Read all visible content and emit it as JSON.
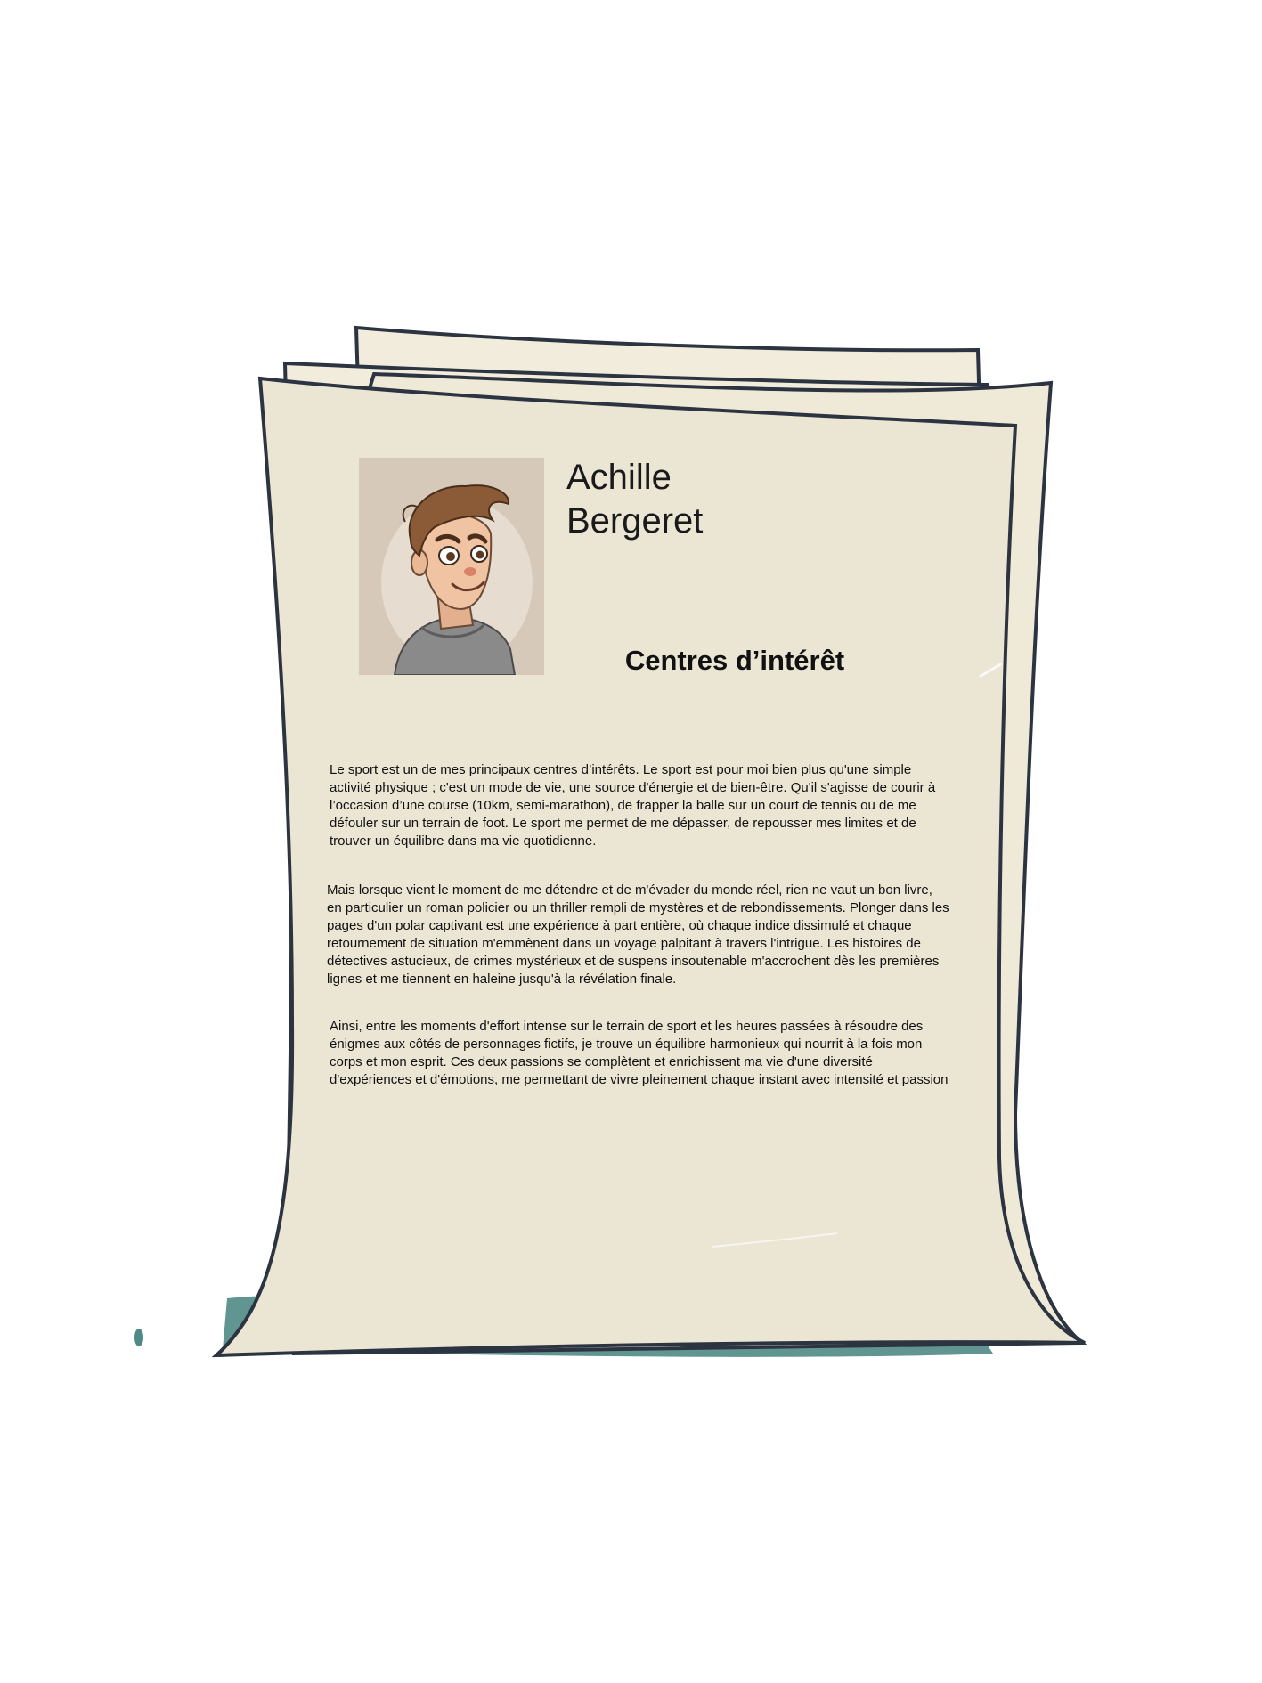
{
  "profile": {
    "first_name": "Achille",
    "last_name": "Bergeret",
    "section_title": "Centres d’intérêt"
  },
  "paragraphs": [
    "Le sport est un de mes principaux centres d’intérêts. Le sport est pour moi bien plus qu'une simple activité physique ; c'est un mode de vie, une source d'énergie et de bien-être. Qu'il s'agisse de courir à l’occasion d’une course (10km, semi-marathon), de frapper la balle sur un court de tennis ou de me défouler sur un terrain de foot. Le sport me permet de me dépasser, de repousser mes limites et de trouver un équilibre dans ma vie quotidienne.",
    "Mais lorsque vient le moment de me détendre et de m'évader du monde réel, rien ne vaut un bon livre, en particulier un roman policier ou un thriller rempli de mystères et de rebondissements. Plonger dans les pages d'un polar captivant est une expérience à part entière, où chaque indice dissimulé et chaque retournement de situation m'emmènent dans un voyage palpitant à travers l'intrigue. Les histoires de détectives astucieux, de crimes mystérieux et de suspens insoutenable m'accrochent dès les premières lignes et me tiennent en haleine jusqu'à la révélation finale.",
    "Ainsi, entre les moments d'effort intense sur le terrain de sport et les heures passées à résoudre des énigmes aux côtés de personnages fictifs, je trouve un équilibre harmonieux qui nourrit à la fois mon corps et mon esprit. Ces deux passions se complètent et enrichissent ma vie d'une diversité d'expériences et d'émotions, me permettant de vivre pleinement chaque instant avec intensité et passion"
  ],
  "colors": {
    "paper": "#ebe5d4",
    "paper_back": "#efe9d8",
    "outline": "#2b3440",
    "shadow": "#4f8a86",
    "portrait_bg": "#d6c9ba"
  }
}
